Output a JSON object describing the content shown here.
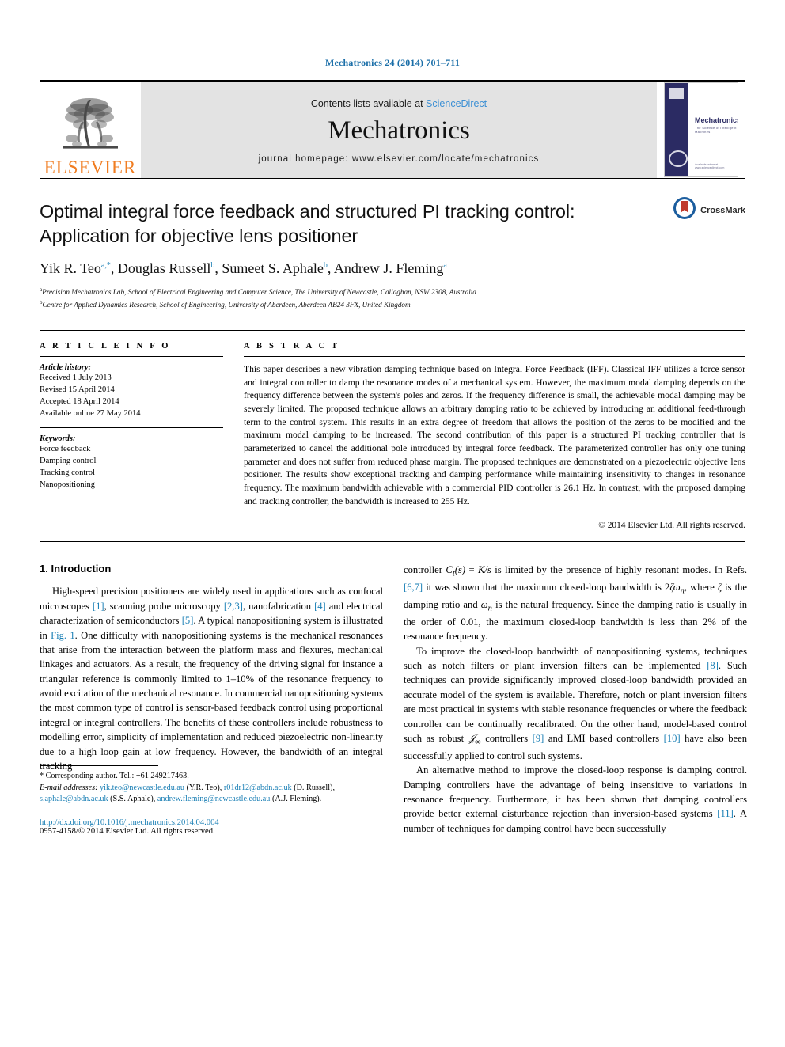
{
  "running_head": "Mechatronics 24 (2014) 701–711",
  "masthead": {
    "publisher_wordmark": "ELSEVIER",
    "contents_prefix": "Contents lists available at ",
    "contents_link": "ScienceDirect",
    "journal_name": "Mechatronics",
    "homepage_line": "journal homepage: www.elsevier.com/locate/mechatronics",
    "cover": {
      "title": "Mechatronics",
      "subtitle": "The Science of Intelligent Machines",
      "footer": "Available online at www.sciencedirect.com"
    }
  },
  "crossmark": {
    "label": "CrossMark"
  },
  "article": {
    "title": "Optimal integral force feedback and structured PI tracking control: Application for objective lens positioner",
    "authors": [
      {
        "name": "Yik R. Teo",
        "marks": "a,*"
      },
      {
        "name": "Douglas Russell",
        "marks": "b"
      },
      {
        "name": "Sumeet S. Aphale",
        "marks": "b"
      },
      {
        "name": "Andrew J. Fleming",
        "marks": "a"
      }
    ],
    "affiliations": [
      {
        "mark": "a",
        "text": "Precision Mechatronics Lab, School of Electrical Engineering and Computer Science, The University of Newcastle, Callaghan, NSW 2308, Australia"
      },
      {
        "mark": "b",
        "text": "Centre for Applied Dynamics Research, School of Engineering, University of Aberdeen, Aberdeen AB24 3FX, United Kingdom"
      }
    ]
  },
  "article_info": {
    "heading": "A R T I C L E   I N F O",
    "history_label": "Article history:",
    "history": [
      "Received 1 July 2013",
      "Revised 15 April 2014",
      "Accepted 18 April 2014",
      "Available online 27 May 2014"
    ],
    "keywords_label": "Keywords:",
    "keywords": [
      "Force feedback",
      "Damping control",
      "Tracking control",
      "Nanopositioning"
    ]
  },
  "abstract": {
    "heading": "A B S T R A C T",
    "text": "This paper describes a new vibration damping technique based on Integral Force Feedback (IFF). Classical IFF utilizes a force sensor and integral controller to damp the resonance modes of a mechanical system. However, the maximum modal damping depends on the frequency difference between the system's poles and zeros. If the frequency difference is small, the achievable modal damping may be severely limited. The proposed technique allows an arbitrary damping ratio to be achieved by introducing an additional feed-through term to the control system. This results in an extra degree of freedom that allows the position of the zeros to be modified and the maximum modal damping to be increased. The second contribution of this paper is a structured PI tracking controller that is parameterized to cancel the additional pole introduced by integral force feedback. The parameterized controller has only one tuning parameter and does not suffer from reduced phase margin. The proposed techniques are demonstrated on a piezoelectric objective lens positioner. The results show exceptional tracking and damping performance while maintaining insensitivity to changes in resonance frequency. The maximum bandwidth achievable with a commercial PID controller is 26.1 Hz. In contrast, with the proposed damping and tracking controller, the bandwidth is increased to 255 Hz.",
    "copyright": "© 2014 Elsevier Ltd. All rights reserved."
  },
  "introduction": {
    "heading": "1. Introduction",
    "left_paragraphs": [
      "High-speed precision positioners are widely used in applications such as confocal microscopes [1], scanning probe microscopy [2,3], nanofabrication [4] and electrical characterization of semiconductors [5]. A typical nanopositioning system is illustrated in Fig. 1. One difficulty with nanopositioning systems is the mechanical resonances that arise from the interaction between the platform mass and flexures, mechanical linkages and actuators. As a result, the frequency of the driving signal for instance a triangular reference is commonly limited to 1–10% of the resonance frequency to avoid excitation of the mechanical resonance. In commercial nanopositioning systems the most common type of control is sensor-based feedback control using proportional integral or integral controllers. The benefits of these controllers include robustness to modelling error, simplicity of implementation and reduced piezoelectric non-linearity due to a high loop gain at low frequency. However, the bandwidth of an integral tracking"
    ],
    "right_paragraphs": [
      "controller Ct(s) = K/s is limited by the presence of highly resonant modes. In Refs. [6,7] it was shown that the maximum closed-loop bandwidth is 2ζωn, where ζ is the damping ratio and ωn is the natural frequency. Since the damping ratio is usually in the order of 0.01, the maximum closed-loop bandwidth is less than 2% of the resonance frequency.",
      "To improve the closed-loop bandwidth of nanopositioning systems, techniques such as notch filters or plant inversion filters can be implemented [8]. Such techniques can provide significantly improved closed-loop bandwidth provided an accurate model of the system is available. Therefore, notch or plant inversion filters are most practical in systems with stable resonance frequencies or where the feedback controller can be continually recalibrated. On the other hand, model-based control such as robust H∞ controllers [9] and LMI based controllers [10] have also been successfully applied to control such systems.",
      "An alternative method to improve the closed-loop response is damping control. Damping controllers have the advantage of being insensitive to variations in resonance frequency. Furthermore, it has been shown that damping controllers provide better external disturbance rejection than inversion-based systems [11]. A number of techniques for damping control have been successfully"
    ]
  },
  "footnotes": {
    "corresponding": "* Corresponding author. Tel.: +61 249217463.",
    "email_label": "E-mail addresses:",
    "emails": [
      {
        "address": "yik.teo@newcastle.edu.au",
        "owner": "(Y.R. Teo)"
      },
      {
        "address": "r01dr12@abdn.ac.uk",
        "owner": "(D. Russell)"
      },
      {
        "address": "s.aphale@abdn.ac.uk",
        "owner": "(S.S. Aphale)"
      },
      {
        "address": "andrew.fleming@newcastle.edu.au",
        "owner": "(A.J. Fleming)"
      }
    ],
    "doi": "http://dx.doi.org/10.1016/j.mechatronics.2014.04.004",
    "issn": "0957-4158/© 2014 Elsevier Ltd. All rights reserved."
  },
  "colors": {
    "link": "#1a7fb5",
    "sciencedirect": "#3b8fd4",
    "elsevier_orange": "#f07d22",
    "running_head": "#1a6ea8",
    "banner_bg": "#e3e3e3"
  }
}
